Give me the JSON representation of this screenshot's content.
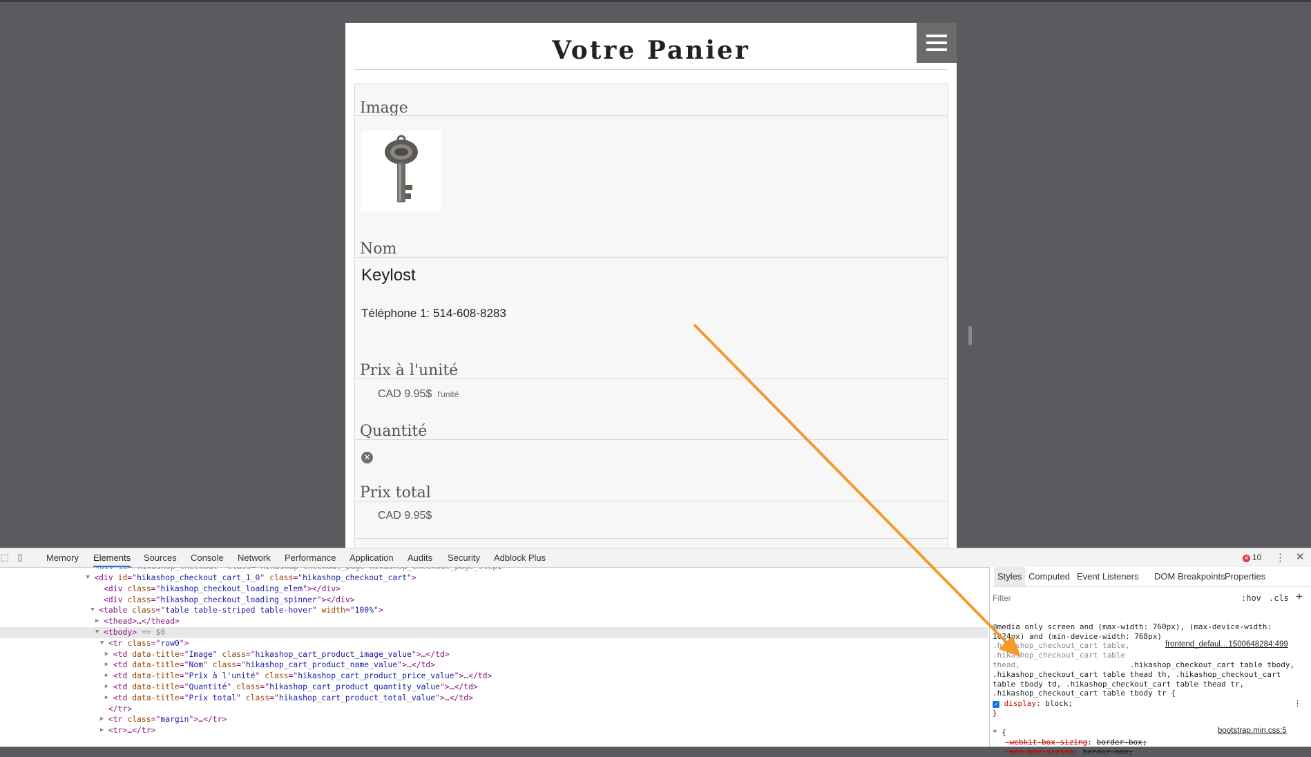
{
  "page": {
    "title": "Votre Panier",
    "menu_icon": "hamburger-menu-icon",
    "cart": {
      "image_label": "Image",
      "name_label": "Nom",
      "product_name": "Keylost",
      "phone": "Téléphone 1: 514-608-8283",
      "unit_price_label": "Prix à l'unité",
      "unit_price": "CAD 9.95$",
      "unit_suffix": "l'unité",
      "quantity_label": "Quantité",
      "remove_icon": "remove-circle-icon",
      "total_label": "Prix total",
      "total": "CAD 9.95$"
    }
  },
  "devtools": {
    "tabs": [
      "Memory",
      "Elements",
      "Sources",
      "Console",
      "Network",
      "Performance",
      "Application",
      "Audits",
      "Security",
      "Adblock Plus"
    ],
    "active_tab": "Elements",
    "error_count": "10",
    "elements_lines": [
      {
        "indent": 19,
        "toggle": "▼",
        "tag": "div",
        "attrs": [
          [
            "id",
            "hikashop_checkout_cart_1_0"
          ],
          [
            "class",
            "hikashop_checkout_cart"
          ]
        ],
        "tail": ">"
      },
      {
        "indent": 21,
        "toggle": "",
        "tag": "div",
        "attrs": [
          [
            "class",
            "hikashop_checkout_loading_elem"
          ]
        ],
        "tail": "></div>"
      },
      {
        "indent": 21,
        "toggle": "",
        "tag": "div",
        "attrs": [
          [
            "class",
            "hikashop_checkout_loading_spinner"
          ]
        ],
        "tail": "></div>"
      },
      {
        "indent": 20,
        "toggle": "▼",
        "tag": "table",
        "attrs": [
          [
            "class",
            "table table-striped table-hover"
          ],
          [
            "width",
            "100%"
          ]
        ],
        "tail": ">"
      },
      {
        "indent": 21,
        "toggle": "▶",
        "tag": "thead",
        "attrs": [],
        "tail": ">…</thead>"
      },
      {
        "indent": 21,
        "toggle": "▼",
        "tag": "tbody",
        "attrs": [],
        "tail": "> == $0",
        "selected": true
      },
      {
        "indent": 22,
        "toggle": "▼",
        "tag": "tr",
        "attrs": [
          [
            "class",
            "row0"
          ]
        ],
        "tail": ">"
      },
      {
        "indent": 23,
        "toggle": "▶",
        "tag": "td",
        "attrs": [
          [
            "data-title",
            "Image"
          ],
          [
            "class",
            "hikashop_cart_product_image_value"
          ]
        ],
        "tail": ">…</td>"
      },
      {
        "indent": 23,
        "toggle": "▶",
        "tag": "td",
        "attrs": [
          [
            "data-title",
            "Nom"
          ],
          [
            "class",
            "hikashop_cart_product_name_value"
          ]
        ],
        "tail": ">…</td>"
      },
      {
        "indent": 23,
        "toggle": "▶",
        "tag": "td",
        "attrs": [
          [
            "data-title",
            "Prix à l'unité"
          ],
          [
            "class",
            "hikashop_cart_product_price_value"
          ]
        ],
        "tail": ">…</td>"
      },
      {
        "indent": 23,
        "toggle": "▶",
        "tag": "td",
        "attrs": [
          [
            "data-title",
            "Quantité"
          ],
          [
            "class",
            "hikashop_cart_product_quantity_value"
          ]
        ],
        "tail": ">…</td>"
      },
      {
        "indent": 23,
        "toggle": "▶",
        "tag": "td",
        "attrs": [
          [
            "data-title",
            "Prix total"
          ],
          [
            "class",
            "hikashop_cart_product_total_value"
          ]
        ],
        "tail": ">…</td>"
      },
      {
        "indent": 22,
        "toggle": "",
        "tag": "/tr",
        "attrs": [],
        "tail": ">"
      },
      {
        "indent": 22,
        "toggle": "▶",
        "tag": "tr",
        "attrs": [
          [
            "class",
            "margin"
          ]
        ],
        "tail": ">…</tr>"
      },
      {
        "indent": 22,
        "toggle": "▶",
        "tag": "tr",
        "attrs": [],
        "tail": ">…</tr>"
      }
    ],
    "styles_panel": {
      "tabs": [
        "Styles",
        "Computed",
        "Event Listeners",
        "DOM Breakpoints",
        "Properties"
      ],
      "active_tab": "Styles",
      "filter_placeholder": "Filter",
      "hov": ":hov",
      "cls": ".cls",
      "media_query": "@media only screen and (max-width: 760px), (max-device-width:\n1024px) and (min-device-width: 768px)",
      "selector_grey": ".hikashop_checkout_cart table,\n.hikashop_checkout_cart table\nthead, ",
      "selector_rest": ".hikashop_checkout_cart table tbody,\n.hikashop_checkout_cart table thead th, .hikashop_checkout_cart\ntable tbody td, .hikashop_checkout_cart table thead tr,\n.hikashop_checkout_cart table tbody tr {",
      "source_1": "frontend_defaul…1500648284:499",
      "declaration_prop": "display",
      "declaration_value": "block;",
      "rule_close": "}",
      "universal_selector": "* {",
      "source_2": "bootstrap.min.css:5",
      "struck_prop": "-webkit-box-sizing",
      "struck_value": "border-box;",
      "struck_prop_2": "-moz-box-sizing",
      "struck_value_2": "border-box;"
    }
  },
  "annotation": {
    "color": "#f39a2b"
  }
}
